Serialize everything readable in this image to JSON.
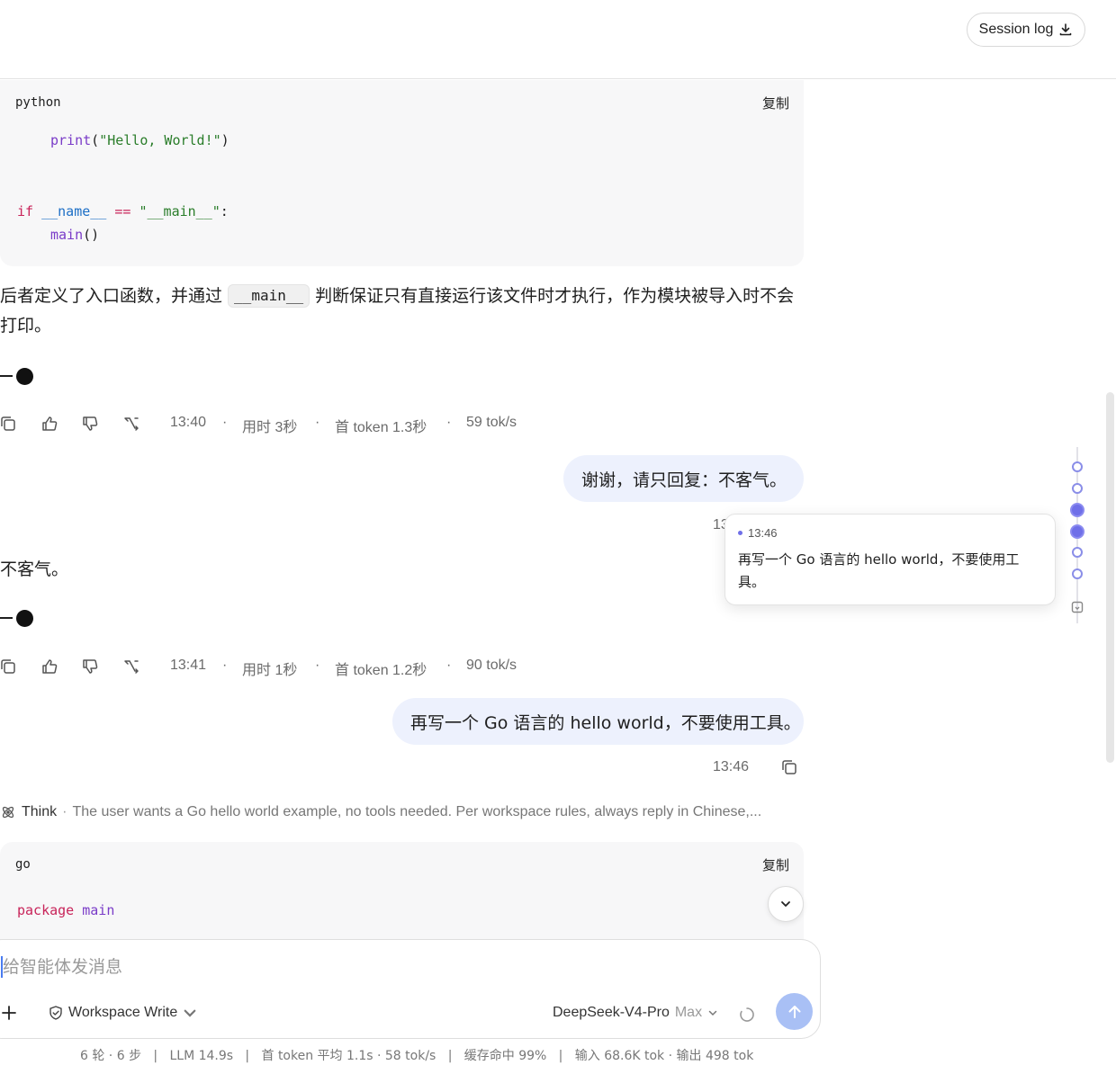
{
  "header": {
    "session_log_label": "Session log"
  },
  "code_block_1": {
    "lang": "python",
    "copy_label": "复制",
    "lines": {
      "l1_fn": "print",
      "l1_open": "(",
      "l1_str": "\"Hello, World!\"",
      "l1_close": ")",
      "l2_if": "if",
      "l2_var": "__name__",
      "l2_op": "==",
      "l2_str": "\"__main__\"",
      "l2_colon": ":",
      "l3_fn": "main",
      "l3_args": "()"
    }
  },
  "assistant_1": {
    "text_before": "后者定义了入口函数，并通过 ",
    "inline_code": "__main__",
    "text_after": " 判断保证只有直接运行该文件时才执行，作为模块被导入时不会打印。"
  },
  "actions_1": {
    "time": "13:40",
    "dot1": "·",
    "duration": "用时 3秒",
    "dot2": "·",
    "first_token": "首 token 1.3秒",
    "dot3": "·",
    "speed": "59 tok/s"
  },
  "user_1": {
    "text": "谢谢，请只回复：不客气。",
    "time": "13"
  },
  "assistant_2": {
    "text": "不客气。"
  },
  "actions_2": {
    "time": "13:41",
    "dot1": "·",
    "duration": "用时 1秒",
    "dot2": "·",
    "first_token": "首 token 1.2秒",
    "dot3": "·",
    "speed": "90 tok/s"
  },
  "user_2": {
    "text": "再写一个 Go 语言的 hello world，不要使用工具。",
    "time": "13:46"
  },
  "think": {
    "label": "Think",
    "sep": "·",
    "text": "The user wants a Go hello world example, no tools needed. Per workspace rules, always reply in Chinese,..."
  },
  "code_block_2": {
    "lang": "go",
    "copy_label": "复制",
    "kw": "package",
    "name": "main"
  },
  "tooltip": {
    "time": "13:46",
    "text": "再写一个 Go 语言的 hello world，不要使用工具。"
  },
  "composer": {
    "placeholder": "给智能体发消息",
    "mode_label": "Workspace Write",
    "model_name": "DeepSeek-V4-Pro",
    "model_tier": "Max"
  },
  "footer": {
    "stats": "6 轮 · 6 步   |   LLM 14.9s   |   首 token 平均 1.1s · 58 tok/s   |   缓存命中 99%   |   输入 68.6K tok · 输出 498 tok"
  },
  "colors": {
    "accent": "#6f6fe8",
    "bubble_bg": "#edf1fd",
    "send_bg": "#a9c0f5",
    "keyword": "#c8245a",
    "function": "#7a3cc8",
    "string": "#2a7d2a"
  }
}
